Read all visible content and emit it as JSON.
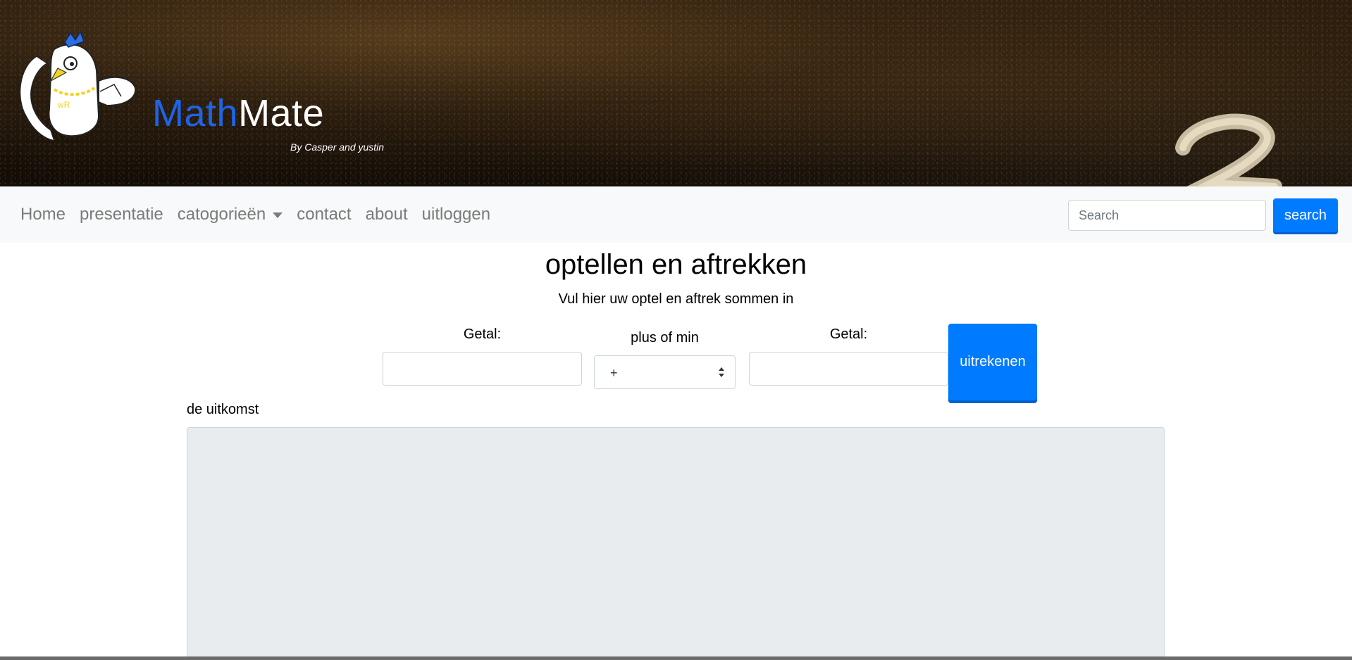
{
  "banner": {
    "logo_part1": "Math",
    "logo_part2": "Mate",
    "byline": "By Casper and yustin",
    "colors": {
      "math": "#1f63e6",
      "mate": "#ffffff"
    }
  },
  "navbar": {
    "items": [
      {
        "label": "Home"
      },
      {
        "label": "presentatie"
      },
      {
        "label": "catogorieën",
        "dropdown": true
      },
      {
        "label": "contact"
      },
      {
        "label": "about"
      },
      {
        "label": "uitloggen"
      }
    ],
    "search": {
      "placeholder": "Search",
      "value": "",
      "button_label": "search"
    }
  },
  "main": {
    "title": "optellen en aftrekken",
    "subtitle": "Vul hier uw optel en aftrek sommen in",
    "form": {
      "number1_label": "Getal:",
      "number1_value": "",
      "operator_label": "plus of min",
      "operator_value": "+",
      "number2_label": "Getal:",
      "number2_value": "",
      "calculate_label": "uitrekenen"
    },
    "result": {
      "label": "de uitkomst",
      "value": ""
    }
  },
  "colors": {
    "primary": "#007bff",
    "navbar_bg": "#f8f9fa",
    "nav_text": "#7a7a7a",
    "readonly_bg": "#e9ecef"
  }
}
